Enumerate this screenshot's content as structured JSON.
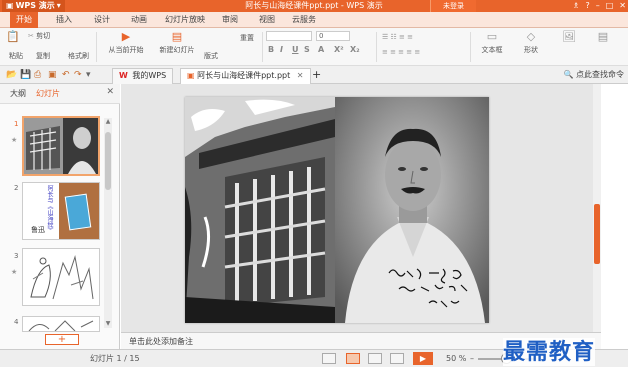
{
  "titlebar": {
    "app_name": "WPS 演示",
    "document_title": "阿长与山海经课件ppt.ppt - WPS 演示",
    "login_label": "未登录",
    "icons": [
      "shirt-icon",
      "help-icon",
      "minimize-icon",
      "maximize-icon",
      "close-icon"
    ]
  },
  "menu": {
    "tabs": [
      "开始",
      "插入",
      "设计",
      "动画",
      "幻灯片放映",
      "审阅",
      "视图",
      "云服务"
    ],
    "active": "开始"
  },
  "ribbon": {
    "cut_label": "剪切",
    "paste_label": "粘贴",
    "copy_label": "复制",
    "format_painter_label": "格式刷",
    "from_current_label": "从当前开始",
    "new_slide_label": "新建幻灯片",
    "layout_label": "版式",
    "reset_label": "重置",
    "font_size_value": "0",
    "textbox_label": "文本框",
    "shape_label": "形状"
  },
  "doc_tabs": {
    "home_tab": "我的WPS",
    "file_tab": "阿长与山海经课件ppt.ppt",
    "add_label": "+"
  },
  "help": {
    "search_label": "点此查找命令"
  },
  "left_panel": {
    "tab_outline": "大纲",
    "tab_slides": "幻灯片",
    "slide_numbers": [
      "1",
      "2",
      "3",
      "4"
    ],
    "thumb2_title": "阿长与《山海经》",
    "thumb2_author": "鲁迅",
    "add_button": "+"
  },
  "slide": {
    "caption": "鲁迅 一九三0年九月 二十五日照 五十岁"
  },
  "notes": {
    "placeholder": "单击此处添加备注"
  },
  "status": {
    "slide_counter": "幻灯片 1 / 15",
    "theme": "",
    "zoom": "50 %",
    "zoom_level": 0.5
  },
  "watermark": "最需教育",
  "colors": {
    "accent": "#e8642b",
    "watermark": "#1f5fc4"
  }
}
